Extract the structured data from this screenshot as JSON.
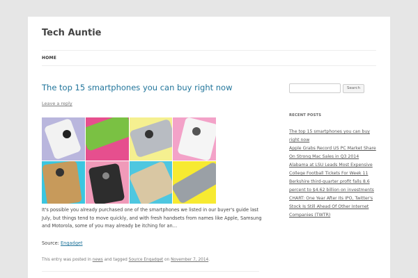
{
  "site": {
    "title": "Tech Auntie"
  },
  "nav": {
    "home": "HOME"
  },
  "post": {
    "title": "The top 15 smartphones you can buy right now",
    "leave_reply": "Leave a reply",
    "excerpt": "It's possible you already purchased one of the smartphones we listed in our buyer's guide last July, but things tend to move quickly, and with fresh handsets from names like Apple, Samsung and Motorola, some of you may already be itching for an…",
    "source_label": "Source: ",
    "source_link": "Engadget",
    "meta": {
      "prefix": "This entry was posted in ",
      "category": "news",
      "tagged": " and tagged ",
      "tag": "Source Engadget",
      "on": " on ",
      "date": "November 7, 2014",
      "end": "."
    }
  },
  "sidebar": {
    "search_placeholder": "",
    "search_button": "Search",
    "recent_title": "RECENT POSTS",
    "recent_posts": [
      "The top 15 smartphones you can buy right now",
      "Apple Grabs Record US PC Market Share On Strong Mac Sales in Q3 2014",
      "Alabama at LSU Leads Most Expensive College Football Tickets For Week 11",
      "Berkshire third-quarter profit falls 8.6 percent to $4.62 billion on investments",
      "CHART: One Year After Its IPO, Twitter's Stock Is Still Ahead Of Other Internet Companies (TWTR)"
    ]
  }
}
